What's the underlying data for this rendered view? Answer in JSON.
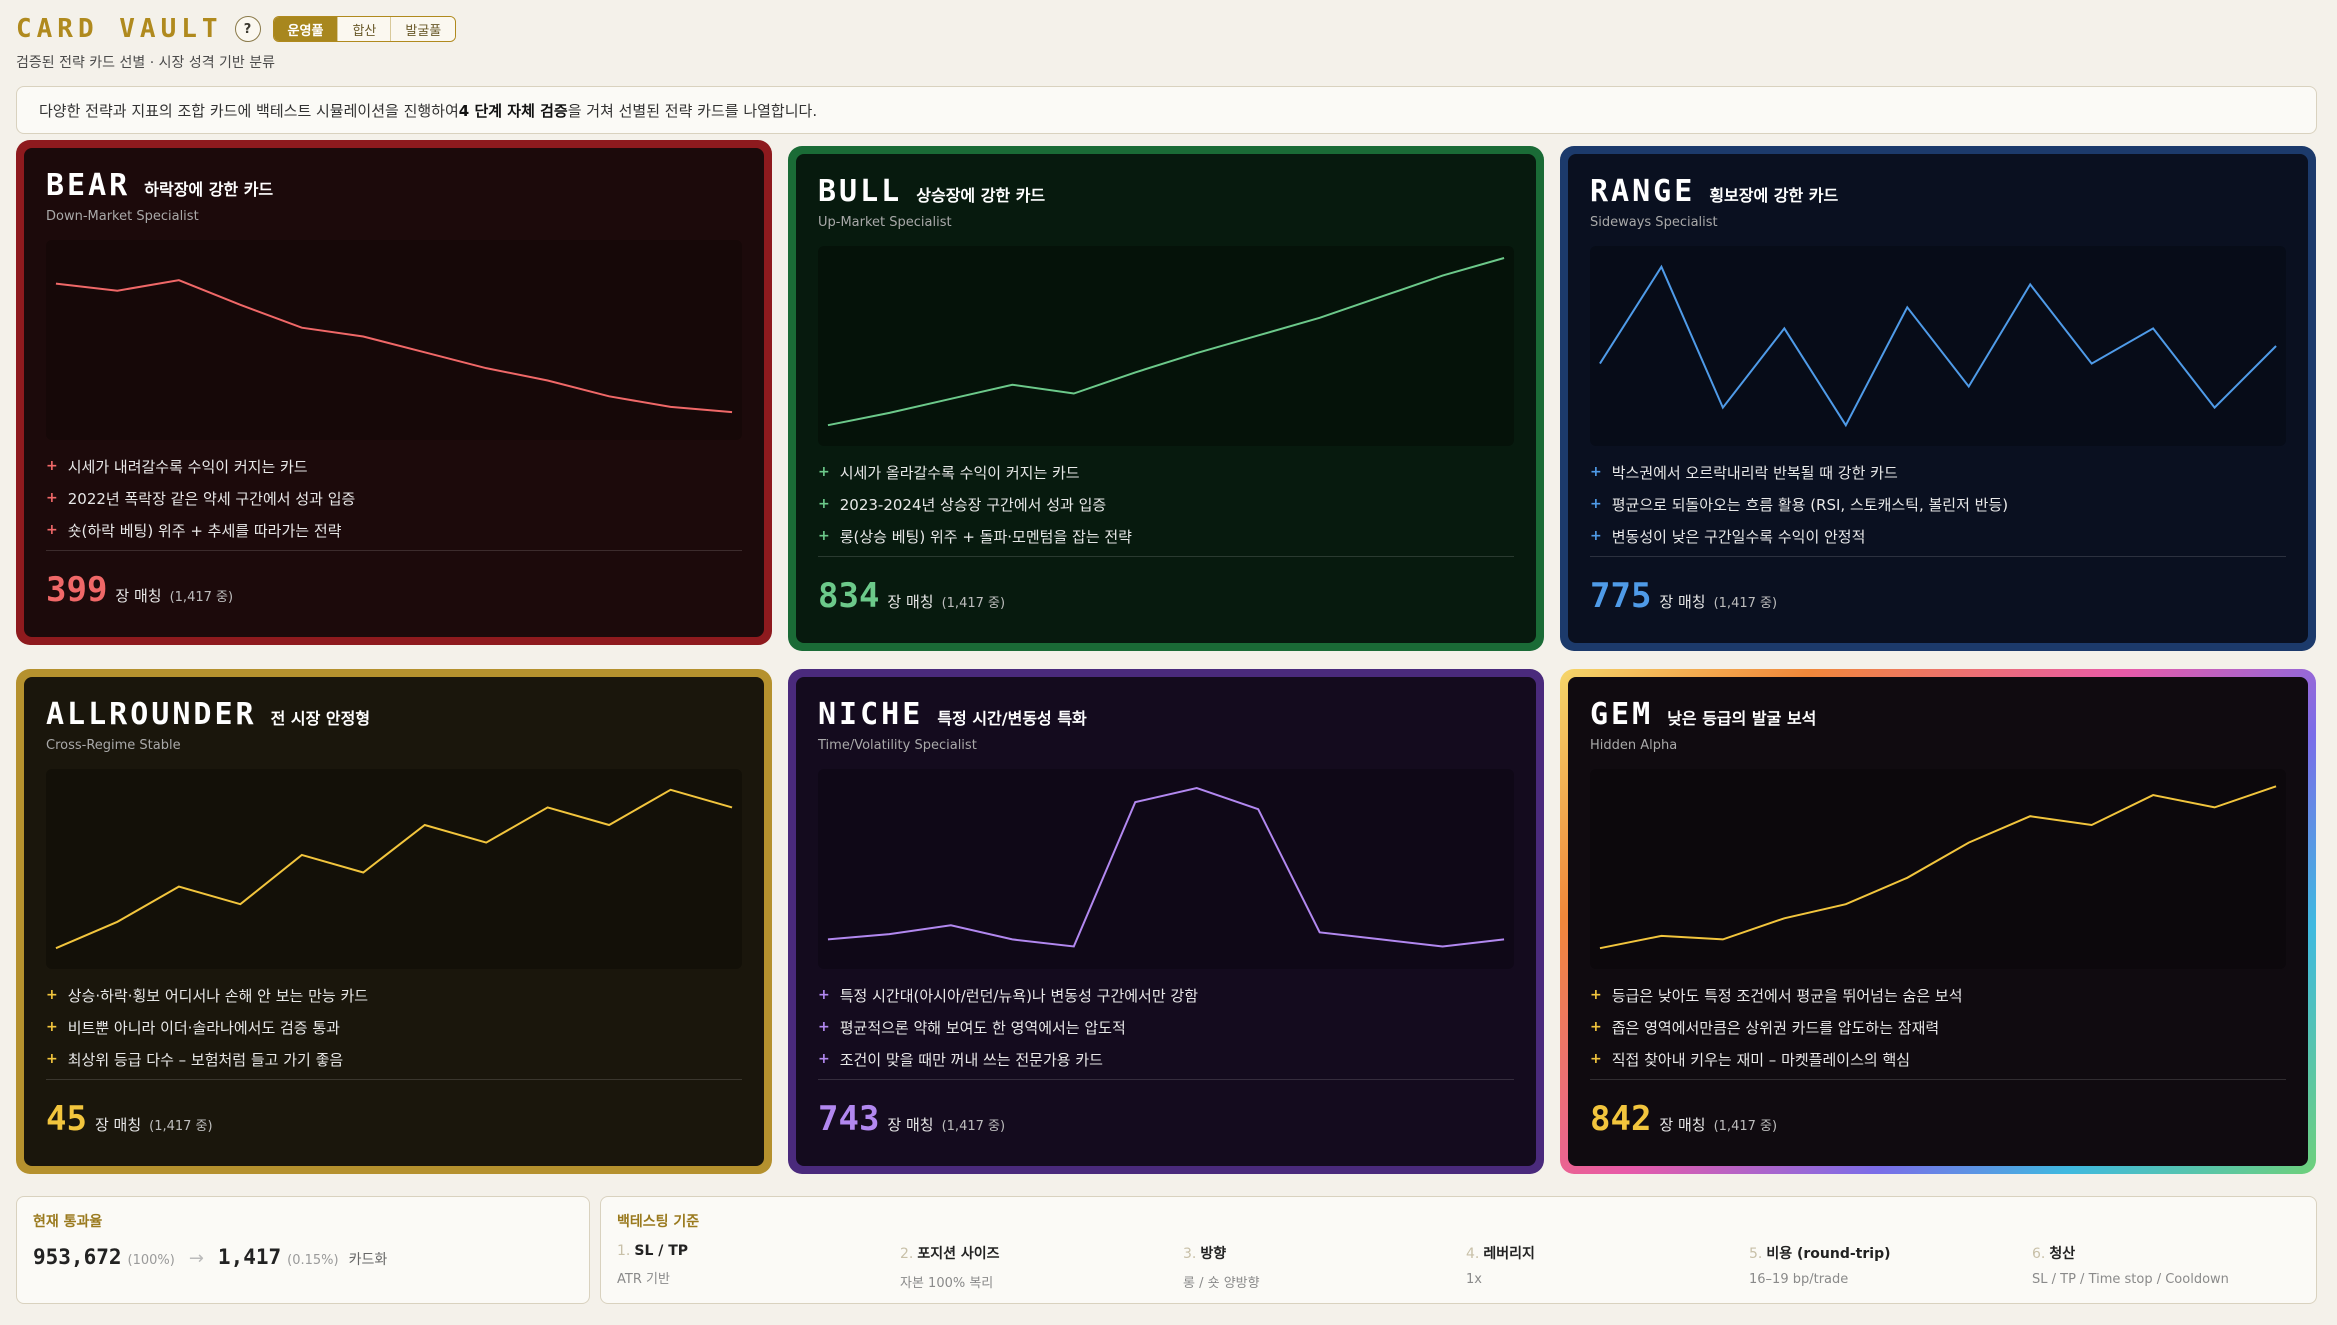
{
  "header": {
    "logo": "CARD VAULT",
    "help": "?",
    "tabs": [
      {
        "label": "운영풀",
        "active": true
      },
      {
        "label": "합산",
        "active": false
      },
      {
        "label": "발굴풀",
        "active": false
      }
    ],
    "subtitle": "검증된 전략 카드 선별 · 시장 성격 기반 분류"
  },
  "notice": {
    "pre": "다양한 전략과 지표의 조합 카드에 백테스트 시뮬레이션을 진행하여 ",
    "bold": "4 단계 자체 검증",
    "post": " 을 거쳐 선별된 전략 카드를 나열합니다."
  },
  "cards": [
    {
      "name": "BEAR",
      "tag": "하락장에 강한 카드",
      "en": "Down-Market Specialist",
      "accent": "#f06868",
      "border": "#8e1a1e",
      "bg": "#1c0a0b",
      "chartbg": "#160808",
      "bullets": [
        "시세가 내려갈수록 수익이 커지는 카드",
        "2022년 폭락장 같은 약세 구간에서 성과 입증",
        "숏(하락 베팅) 위주 + 추세를 따라가는 전략"
      ],
      "count": "399",
      "count_label": "장 매칭",
      "count_total": "(1,417 중)",
      "series": [
        82,
        78,
        84,
        70,
        57,
        52,
        43,
        34,
        27,
        18,
        12,
        9
      ]
    },
    {
      "name": "BULL",
      "tag": "상승장에 강한 카드",
      "en": "Up-Market Specialist",
      "accent": "#6cc98a",
      "border": "#1a6b36",
      "bg": "#071a0e",
      "chartbg": "#051209",
      "bullets": [
        "시세가 올라갈수록 수익이 커지는 카드",
        "2023-2024년 상승장 구간에서 성과 입증",
        "롱(상승 베팅) 위주 + 돌파·모멘텀을 잡는 전략"
      ],
      "count": "834",
      "count_label": "장 매칭",
      "count_total": "(1,417 중)",
      "series": [
        5,
        12,
        20,
        28,
        23,
        35,
        46,
        56,
        66,
        78,
        90,
        100
      ]
    },
    {
      "name": "RANGE",
      "tag": "횡보장에 강한 카드",
      "en": "Sideways Specialist",
      "accent": "#4f9be8",
      "border": "#1c3a6b",
      "bg": "#0a1020",
      "chartbg": "#070c18",
      "bullets": [
        "박스권에서 오르락내리락 반복될 때 강한 카드",
        "평균으로 되돌아오는 흐름 활용 (RSI, 스토캐스틱, 볼린저 반등)",
        "변동성이 낮은 구간일수록 수익이 안정적"
      ],
      "count": "775",
      "count_label": "장 매칭",
      "count_total": "(1,417 중)",
      "series": [
        40,
        95,
        15,
        60,
        5,
        72,
        27,
        85,
        40,
        60,
        15,
        50
      ]
    },
    {
      "name": "ALLROUNDER",
      "tag": "전 시장 안정형",
      "en": "Cross-Regime Stable",
      "accent": "#f2c53d",
      "border": "#b5912e",
      "bg": "#1a160c",
      "chartbg": "#131008",
      "bullets": [
        "상승·하락·횡보 어디서나 손해 안 보는 만능 카드",
        "비트뿐 아니라 이더·솔라나에서도 검증 통과",
        "최상위 등급 다수 – 보험처럼 들고 가기 좋음"
      ],
      "count": "45",
      "count_label": "장 매칭",
      "count_total": "(1,417 중)",
      "series": [
        5,
        20,
        40,
        30,
        58,
        48,
        75,
        65,
        85,
        75,
        95,
        85
      ]
    },
    {
      "name": "NICHE",
      "tag": "특정 시간/변동성 특화",
      "en": "Time/Volatility Specialist",
      "accent": "#b288f0",
      "border": "#4a2a7c",
      "bg": "#140b1e",
      "chartbg": "#0f0817",
      "bullets": [
        "특정 시간대(아시아/런던/뉴욕)나 변동성 구간에서만 강함",
        "평균적으론 약해 보여도 한 영역에서는 압도적",
        "조건이 맞을 때만 꺼내 쓰는 전문가용 카드"
      ],
      "count": "743",
      "count_label": "장 매칭",
      "count_total": "(1,417 중)",
      "series": [
        10,
        13,
        18,
        10,
        6,
        88,
        96,
        84,
        14,
        10,
        6,
        10
      ]
    },
    {
      "name": "GEM",
      "tag": "낮은 등급의 발굴 보석",
      "en": "Hidden Alpha",
      "accent": "#f2c53d",
      "border": "rainbow",
      "bg": "#100b10",
      "chartbg": "#0c080c",
      "bullets": [
        "등급은 낮아도 특정 조건에서 평균을 뛰어넘는 숨은 보석",
        "좁은 영역에서만큼은 상위권 카드를 압도하는 잠재력",
        "직접 찾아내 키우는 재미 – 마켓플레이스의 핵심"
      ],
      "count": "842",
      "count_label": "장 매칭",
      "count_total": "(1,417 중)",
      "series": [
        5,
        12,
        10,
        22,
        30,
        45,
        65,
        80,
        75,
        92,
        85,
        97
      ]
    }
  ],
  "pass": {
    "title": "현재 통과율",
    "total": "953,672",
    "total_pct": "(100%)",
    "arrow": "→",
    "passed": "1,417",
    "passed_pct": "(0.15%)",
    "unit": "카드화"
  },
  "criteria": {
    "title": "백테스팅 기준",
    "items": [
      {
        "num": "1.",
        "title": "SL / TP",
        "sub": "ATR 기반"
      },
      {
        "num": "2.",
        "title": "포지션 사이즈",
        "sub": "자본 100% 복리"
      },
      {
        "num": "3.",
        "title": "방향",
        "sub": "롱 / 숏 양방향"
      },
      {
        "num": "4.",
        "title": "레버리지",
        "sub": "1x"
      },
      {
        "num": "5.",
        "title": "비용 (round-trip)",
        "sub": "16–19 bp/trade"
      },
      {
        "num": "6.",
        "title": "청산",
        "sub": "SL / TP / Time stop / Cooldown"
      }
    ]
  }
}
